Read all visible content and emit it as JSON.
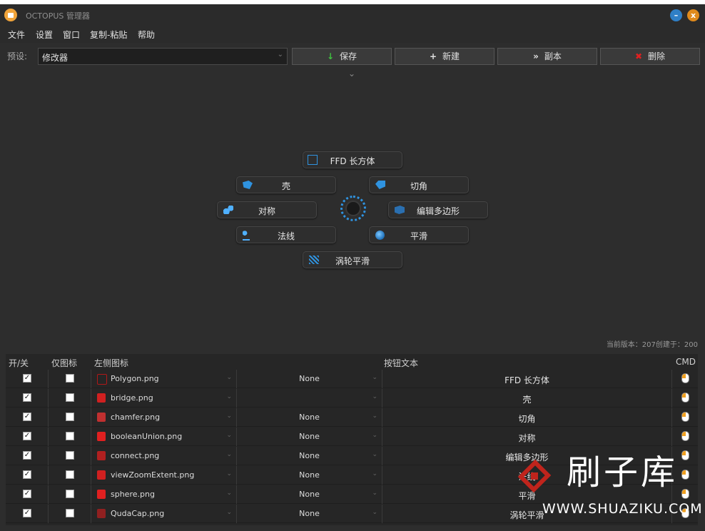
{
  "window": {
    "title": "OCTOPUS 管理器",
    "minimize": "–",
    "close": "x"
  },
  "menubar": [
    "文件",
    "设置",
    "窗口",
    "复制-粘贴",
    "帮助"
  ],
  "preset": {
    "label": "预设:",
    "value": "修改器"
  },
  "toolbar": {
    "save": {
      "label": "保存",
      "icon": "↓",
      "icon_color": "#3fc23f"
    },
    "new": {
      "label": "新建",
      "icon": "+",
      "icon_color": "#ffffff"
    },
    "copy": {
      "label": "副本",
      "icon": "»",
      "icon_color": "#ffffff"
    },
    "delete": {
      "label": "删除",
      "icon": "✖",
      "icon_color": "#e02020"
    }
  },
  "quad_menu": [
    {
      "label": "FFD 长方体",
      "icon": "square-outline-icon"
    },
    {
      "label": "壳",
      "icon": "shell-icon"
    },
    {
      "label": "切角",
      "icon": "chamfer-icon"
    },
    {
      "label": "对称",
      "icon": "symmetry-icon"
    },
    {
      "label": "编辑多边形",
      "icon": "edit-poly-icon"
    },
    {
      "label": "法线",
      "icon": "normal-icon"
    },
    {
      "label": "平滑",
      "icon": "smooth-icon"
    },
    {
      "label": "涡轮平滑",
      "icon": "turbosmooth-icon"
    }
  ],
  "version_text": "当前版本：207创建于：200",
  "table": {
    "headers": {
      "onoff": "开/关",
      "icon_only": "仅图标",
      "left_icon": "左侧图标",
      "btn_text": "按钮文本",
      "cmd": "CMD"
    },
    "rows": [
      {
        "on": true,
        "icon_only": false,
        "icon_file": "Polygon.png",
        "right": "None",
        "text": "FFD 长方体"
      },
      {
        "on": true,
        "icon_only": false,
        "icon_file": "bridge.png",
        "right": "",
        "text": "壳"
      },
      {
        "on": true,
        "icon_only": false,
        "icon_file": "chamfer.png",
        "right": "None",
        "text": "切角"
      },
      {
        "on": true,
        "icon_only": false,
        "icon_file": "booleanUnion.png",
        "right": "None",
        "text": "对称"
      },
      {
        "on": true,
        "icon_only": false,
        "icon_file": "connect.png",
        "right": "None",
        "text": "编辑多边形"
      },
      {
        "on": true,
        "icon_only": false,
        "icon_file": "viewZoomExtent.png",
        "right": "None",
        "text": "法线"
      },
      {
        "on": true,
        "icon_only": false,
        "icon_file": "sphere.png",
        "right": "None",
        "text": "平滑"
      },
      {
        "on": true,
        "icon_only": false,
        "icon_file": "QudaCap.png",
        "right": "None",
        "text": "涡轮平滑"
      }
    ]
  },
  "watermark": {
    "main": "刷子库",
    "url": "WWW.SHUAZIKU.COM"
  },
  "colors": {
    "accent_blue": "#2f93e0",
    "title_orange": "#f1a43a",
    "close_orange": "#e08a1c"
  }
}
